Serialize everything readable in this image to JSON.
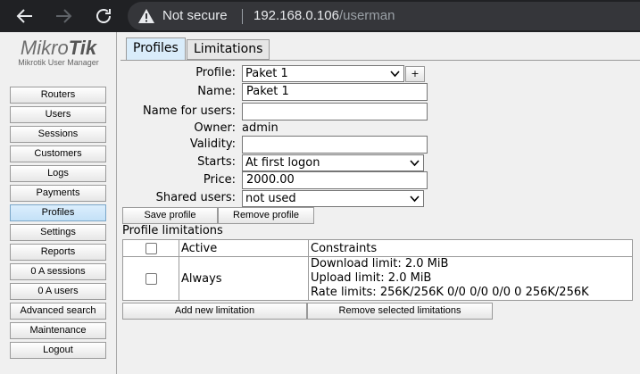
{
  "browser": {
    "not_secure": "Not secure",
    "url_host": "192.168.0.106",
    "url_path": "/userman"
  },
  "logo": {
    "brand_a": "Mikro",
    "brand_b": "Tik",
    "subtitle": "Mikrotik User Manager"
  },
  "sidebar": {
    "items": [
      "Routers",
      "Users",
      "Sessions",
      "Customers",
      "Logs",
      "Payments",
      "Profiles",
      "Settings",
      "Reports",
      "0 A sessions",
      "0 A users",
      "Advanced search",
      "Maintenance",
      "Logout"
    ],
    "active": "Profiles"
  },
  "tabs": {
    "profiles": "Profiles",
    "limitations": "Limitations"
  },
  "form": {
    "profile_label": "Profile:",
    "profile_value": "Paket 1",
    "plus_label": "+",
    "name_label": "Name:",
    "name_value": "Paket 1",
    "name_for_users_label": "Name for users:",
    "name_for_users_value": "",
    "owner_label": "Owner:",
    "owner_value": "admin",
    "validity_label": "Validity:",
    "validity_value": "",
    "starts_label": "Starts:",
    "starts_value": "At first logon",
    "price_label": "Price:",
    "price_value": "2000.00",
    "shared_label": "Shared users:",
    "shared_value": "not used"
  },
  "buttons": {
    "save": "Save profile",
    "remove": "Remove profile",
    "add_limitation": "Add new limitation",
    "remove_selected": "Remove selected limitations"
  },
  "limitations": {
    "title": "Profile limitations",
    "headers": [
      "Active",
      "Constraints"
    ],
    "rows": [
      {
        "active": "Always",
        "constraints": [
          "Download limit: 2.0 MiB",
          "Upload limit: 2.0 MiB",
          "Rate limits: 256K/256K 0/0 0/0 0/0 0 256K/256K"
        ]
      }
    ]
  },
  "colors": {
    "chrome_bg": "#202124",
    "omnibox_bg": "#35363a",
    "active_tab": "#d9ecfa"
  }
}
